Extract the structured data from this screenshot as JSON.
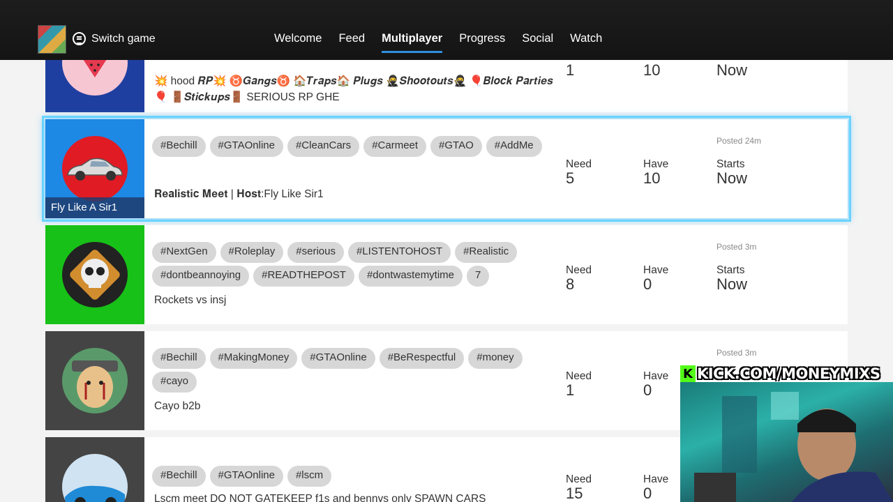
{
  "header": {
    "switch_label": "Switch game",
    "tabs": [
      {
        "label": "Welcome",
        "active": false
      },
      {
        "label": "Feed",
        "active": false
      },
      {
        "label": "Multiplayer",
        "active": true
      },
      {
        "label": "Progress",
        "active": false
      },
      {
        "label": "Social",
        "active": false
      },
      {
        "label": "Watch",
        "active": false
      }
    ]
  },
  "stat_labels": {
    "need": "Need",
    "have": "Have",
    "starts": "Starts"
  },
  "posts": [
    {
      "tags": [],
      "description": "💥 hood 𝑹𝑷💥 ♉𝑮𝒂𝒏𝒈𝒔♉ 🏠𝑻𝒓𝒂𝒑𝒔🏠 𝑷𝒍𝒖𝒈𝒔 🥷𝑺𝒉𝒐𝒐𝒕𝒐𝒖𝒕𝒔🥷 🎈𝑩𝒍𝒐𝒄𝒌 𝑷𝒂𝒓𝒕𝒊𝒆𝒔🎈 🚪𝑺𝒕𝒊𝒄𝒌𝒖𝒑𝒔🚪 SERIOUS RP GHE",
      "need": "1",
      "have": "10",
      "starts": "Now",
      "posted": "",
      "avatar_color": "#1f3fa0",
      "avatar_icon": "watermelon-icon"
    },
    {
      "tags": [
        "#Bechill",
        "#GTAOnline",
        "#CleanCars",
        "#Carmeet",
        "#GTAO",
        "#AddMe"
      ],
      "description": "𝐑𝐞𝐚𝐥𝐢𝐬𝐭𝐢𝐜 𝐌𝐞𝐞𝐭 | 𝐇𝐨𝐬𝐭:Fly Like Sir1",
      "need": "5",
      "have": "10",
      "starts": "Now",
      "posted": "Posted 24m",
      "owner": "Fly Like A Sir1",
      "avatar_color": "#1e88e5",
      "avatar_icon": "car-icon"
    },
    {
      "tags": [
        "#NextGen",
        "#Roleplay",
        "#serious",
        "#LISTENTOHOST",
        "#Realistic",
        "#dontbeannoying",
        "#READTHEPOST",
        "#dontwastemytime",
        "7"
      ],
      "description": "Rockets vs insj",
      "need": "8",
      "have": "0",
      "starts": "Now",
      "posted": "Posted 3m",
      "avatar_color": "#17c117",
      "avatar_icon": "skull-icon"
    },
    {
      "tags": [
        "#Bechill",
        "#MakingMoney",
        "#GTAOnline",
        "#BeRespectful",
        "#money",
        "#cayo"
      ],
      "description": "Cayo b2b",
      "need": "1",
      "have": "0",
      "starts": "",
      "posted": "Posted 3m",
      "avatar_color": "#444444",
      "avatar_icon": "anime-character-icon"
    },
    {
      "tags": [
        "#Bechill",
        "#GTAOnline",
        "#lscm"
      ],
      "description": "Lscm meet DO NOT GATEKEEP f1s and bennys only SPAWN CARS",
      "need": "15",
      "have": "0",
      "starts": "",
      "posted": "",
      "avatar_color": "#444444",
      "avatar_icon": "sports-car-icon"
    }
  ],
  "overlay": {
    "kick_letter": "K",
    "kick_url": "KICK.COM/MONEYMIXS"
  }
}
